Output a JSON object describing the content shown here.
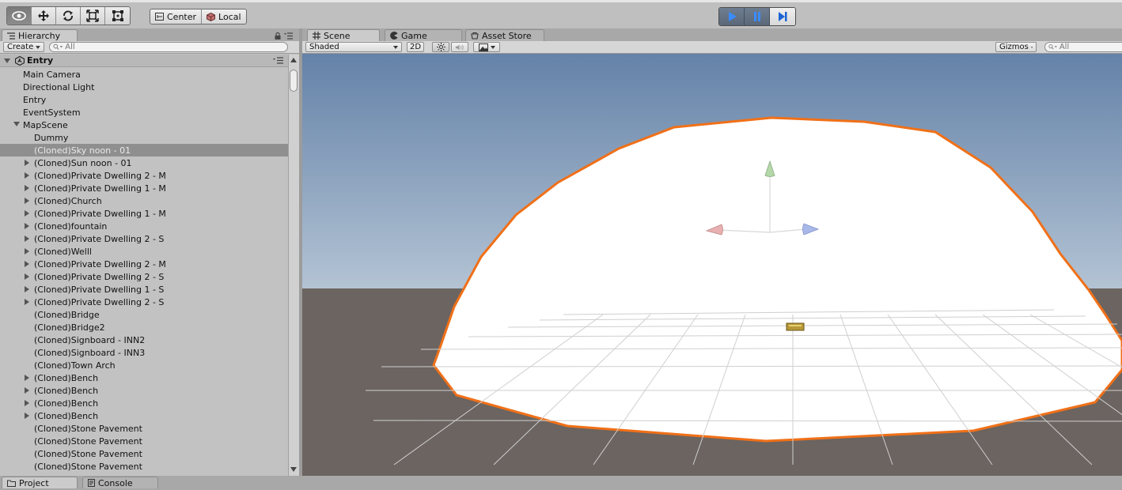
{
  "toolbar": {
    "tools": [
      "view-icon",
      "move-icon",
      "rotate-icon",
      "scale-icon",
      "rect-icon"
    ],
    "pivot_label": "Center",
    "space_label": "Local"
  },
  "hierarchy": {
    "tab_label": "Hierarchy",
    "create_label": "Create",
    "search_placeholder": "All",
    "scene_name": "Entry",
    "items": [
      {
        "label": "Main Camera",
        "indent": 0,
        "expand": "none"
      },
      {
        "label": "Directional Light",
        "indent": 0,
        "expand": "none"
      },
      {
        "label": "Entry",
        "indent": 0,
        "expand": "none"
      },
      {
        "label": "EventSystem",
        "indent": 0,
        "expand": "none"
      },
      {
        "label": "MapScene",
        "indent": 0,
        "expand": "open"
      },
      {
        "label": "Dummy",
        "indent": 1,
        "expand": "none"
      },
      {
        "label": "(Cloned)Sky noon - 01",
        "indent": 1,
        "expand": "none",
        "selected": true
      },
      {
        "label": "(Cloned)Sun noon - 01",
        "indent": 1,
        "expand": "closed"
      },
      {
        "label": "(Cloned)Private Dwelling 2 - M",
        "indent": 1,
        "expand": "closed"
      },
      {
        "label": "(Cloned)Private Dwelling 1 - M",
        "indent": 1,
        "expand": "closed"
      },
      {
        "label": "(Cloned)Church",
        "indent": 1,
        "expand": "closed"
      },
      {
        "label": "(Cloned)Private Dwelling 1 - M",
        "indent": 1,
        "expand": "closed"
      },
      {
        "label": "(Cloned)fountain",
        "indent": 1,
        "expand": "closed"
      },
      {
        "label": "(Cloned)Private Dwelling 2 - S",
        "indent": 1,
        "expand": "closed"
      },
      {
        "label": "(Cloned)Welll",
        "indent": 1,
        "expand": "closed"
      },
      {
        "label": "(Cloned)Private Dwelling 2 - M",
        "indent": 1,
        "expand": "closed"
      },
      {
        "label": "(Cloned)Private Dwelling 2 - S",
        "indent": 1,
        "expand": "closed"
      },
      {
        "label": "(Cloned)Private Dwelling 1 - S",
        "indent": 1,
        "expand": "closed"
      },
      {
        "label": "(Cloned)Private Dwelling 2 - S",
        "indent": 1,
        "expand": "closed"
      },
      {
        "label": "(Cloned)Bridge",
        "indent": 1,
        "expand": "none"
      },
      {
        "label": "(Cloned)Bridge2",
        "indent": 1,
        "expand": "none"
      },
      {
        "label": "(Cloned)Signboard - INN2",
        "indent": 1,
        "expand": "none"
      },
      {
        "label": "(Cloned)Signboard - INN3",
        "indent": 1,
        "expand": "none"
      },
      {
        "label": "(Cloned)Town Arch",
        "indent": 1,
        "expand": "none"
      },
      {
        "label": "(Cloned)Bench",
        "indent": 1,
        "expand": "closed"
      },
      {
        "label": "(Cloned)Bench",
        "indent": 1,
        "expand": "closed"
      },
      {
        "label": "(Cloned)Bench",
        "indent": 1,
        "expand": "closed"
      },
      {
        "label": "(Cloned)Bench",
        "indent": 1,
        "expand": "closed"
      },
      {
        "label": "(Cloned)Stone Pavement",
        "indent": 1,
        "expand": "none"
      },
      {
        "label": "(Cloned)Stone Pavement",
        "indent": 1,
        "expand": "none"
      },
      {
        "label": "(Cloned)Stone Pavement",
        "indent": 1,
        "expand": "none"
      },
      {
        "label": "(Cloned)Stone Pavement",
        "indent": 1,
        "expand": "none"
      }
    ]
  },
  "scene": {
    "tabs": [
      {
        "label": "Scene",
        "icon": "grid-icon"
      },
      {
        "label": "Game",
        "icon": "pacman-icon"
      },
      {
        "label": "Asset Store",
        "icon": "store-icon"
      }
    ],
    "shading_mode": "Shaded",
    "mode_2d_label": "2D",
    "gizmos_label": "Gizmos",
    "search_placeholder": "All"
  },
  "bottom_tabs": [
    {
      "label": "Project",
      "icon": "folder-icon"
    },
    {
      "label": "Console",
      "icon": "console-icon"
    }
  ],
  "colors": {
    "sky_top": "#6482a8",
    "sky_horizon": "#b3c3d4",
    "ground": "#6b6460",
    "dome_outline": "#f07018",
    "play_active": "#5d6b7c",
    "selected_row": "#8f8f8f"
  }
}
